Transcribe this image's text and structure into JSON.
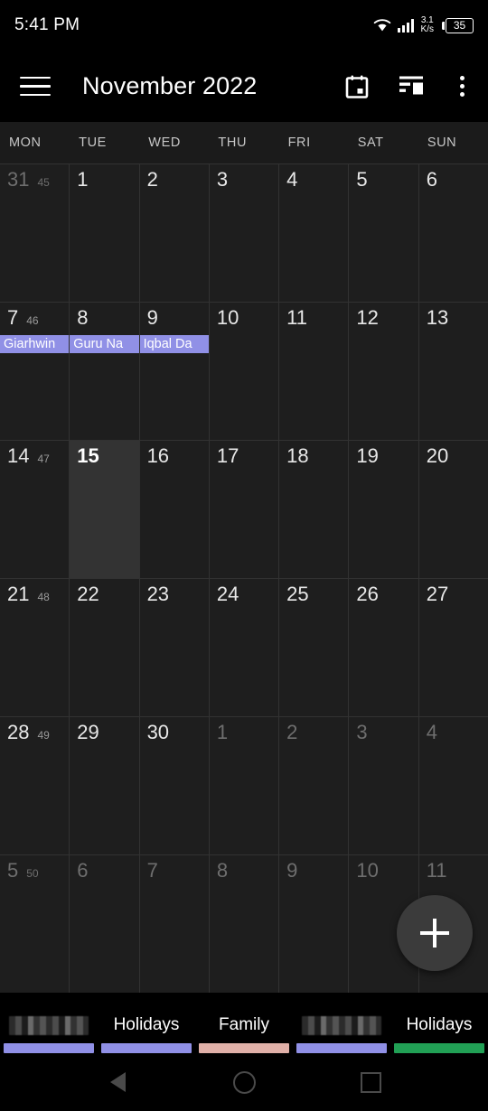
{
  "status_bar": {
    "clock": "5:41 PM",
    "network_speed_value": "3.1",
    "network_speed_unit": "K/s",
    "battery_level": "35",
    "wifi_icon": "wifi-icon",
    "signal_icon": "signal-bars-icon",
    "battery_icon": "battery-icon"
  },
  "toolbar": {
    "menu_icon": "hamburger-menu-icon",
    "title": "November 2022",
    "today_icon": "calendar-today-icon",
    "view_switch_icon": "view-switcher-icon",
    "overflow_icon": "overflow-menu-icon"
  },
  "weekdays": [
    "MON",
    "TUE",
    "WED",
    "THU",
    "FRI",
    "SAT",
    "SUN"
  ],
  "calendar": {
    "month": "November",
    "year": "2022",
    "today": "15",
    "event_chip_color": "#9090e6",
    "weeks": [
      {
        "week_number": "45",
        "days": [
          {
            "num": "31",
            "out": true,
            "today": false,
            "events": []
          },
          {
            "num": "1",
            "out": false,
            "today": false,
            "events": []
          },
          {
            "num": "2",
            "out": false,
            "today": false,
            "events": []
          },
          {
            "num": "3",
            "out": false,
            "today": false,
            "events": []
          },
          {
            "num": "4",
            "out": false,
            "today": false,
            "events": []
          },
          {
            "num": "5",
            "out": false,
            "today": false,
            "events": []
          },
          {
            "num": "6",
            "out": false,
            "today": false,
            "events": []
          }
        ]
      },
      {
        "week_number": "46",
        "days": [
          {
            "num": "7",
            "out": false,
            "today": false,
            "events": [
              {
                "title": "Giarhwin",
                "color": "#9090e6"
              }
            ]
          },
          {
            "num": "8",
            "out": false,
            "today": false,
            "events": [
              {
                "title": "Guru Na",
                "color": "#9090e6"
              }
            ]
          },
          {
            "num": "9",
            "out": false,
            "today": false,
            "events": [
              {
                "title": "Iqbal Da",
                "color": "#9090e6"
              }
            ]
          },
          {
            "num": "10",
            "out": false,
            "today": false,
            "events": []
          },
          {
            "num": "11",
            "out": false,
            "today": false,
            "events": []
          },
          {
            "num": "12",
            "out": false,
            "today": false,
            "events": []
          },
          {
            "num": "13",
            "out": false,
            "today": false,
            "events": []
          }
        ]
      },
      {
        "week_number": "47",
        "days": [
          {
            "num": "14",
            "out": false,
            "today": false,
            "events": []
          },
          {
            "num": "15",
            "out": false,
            "today": true,
            "events": []
          },
          {
            "num": "16",
            "out": false,
            "today": false,
            "events": []
          },
          {
            "num": "17",
            "out": false,
            "today": false,
            "events": []
          },
          {
            "num": "18",
            "out": false,
            "today": false,
            "events": []
          },
          {
            "num": "19",
            "out": false,
            "today": false,
            "events": []
          },
          {
            "num": "20",
            "out": false,
            "today": false,
            "events": []
          }
        ]
      },
      {
        "week_number": "48",
        "days": [
          {
            "num": "21",
            "out": false,
            "today": false,
            "events": []
          },
          {
            "num": "22",
            "out": false,
            "today": false,
            "events": []
          },
          {
            "num": "23",
            "out": false,
            "today": false,
            "events": []
          },
          {
            "num": "24",
            "out": false,
            "today": false,
            "events": []
          },
          {
            "num": "25",
            "out": false,
            "today": false,
            "events": []
          },
          {
            "num": "26",
            "out": false,
            "today": false,
            "events": []
          },
          {
            "num": "27",
            "out": false,
            "today": false,
            "events": []
          }
        ]
      },
      {
        "week_number": "49",
        "days": [
          {
            "num": "28",
            "out": false,
            "today": false,
            "events": []
          },
          {
            "num": "29",
            "out": false,
            "today": false,
            "events": []
          },
          {
            "num": "30",
            "out": false,
            "today": false,
            "events": []
          },
          {
            "num": "1",
            "out": true,
            "today": false,
            "events": []
          },
          {
            "num": "2",
            "out": true,
            "today": false,
            "events": []
          },
          {
            "num": "3",
            "out": true,
            "today": false,
            "events": []
          },
          {
            "num": "4",
            "out": true,
            "today": false,
            "events": []
          }
        ]
      },
      {
        "week_number": "50",
        "days": [
          {
            "num": "5",
            "out": true,
            "today": false,
            "events": []
          },
          {
            "num": "6",
            "out": true,
            "today": false,
            "events": []
          },
          {
            "num": "7",
            "out": true,
            "today": false,
            "events": []
          },
          {
            "num": "8",
            "out": true,
            "today": false,
            "events": []
          },
          {
            "num": "9",
            "out": true,
            "today": false,
            "events": []
          },
          {
            "num": "10",
            "out": true,
            "today": false,
            "events": []
          },
          {
            "num": "11",
            "out": true,
            "today": false,
            "events": []
          }
        ]
      }
    ]
  },
  "fab": {
    "icon": "plus-icon",
    "label": "Add event"
  },
  "legend": {
    "items": [
      {
        "label": "",
        "redacted": true,
        "color": "#9090e6"
      },
      {
        "label": "Holidays",
        "redacted": false,
        "color": "#9090e6"
      },
      {
        "label": "Family",
        "redacted": false,
        "color": "#e0b0a8"
      },
      {
        "label": "",
        "redacted": true,
        "color": "#9090e6"
      },
      {
        "label": "Holidays",
        "redacted": false,
        "color": "#21a055"
      }
    ]
  },
  "nav_bar": {
    "back_icon": "back-triangle-icon",
    "home_icon": "home-circle-icon",
    "recents_icon": "recents-square-icon"
  }
}
